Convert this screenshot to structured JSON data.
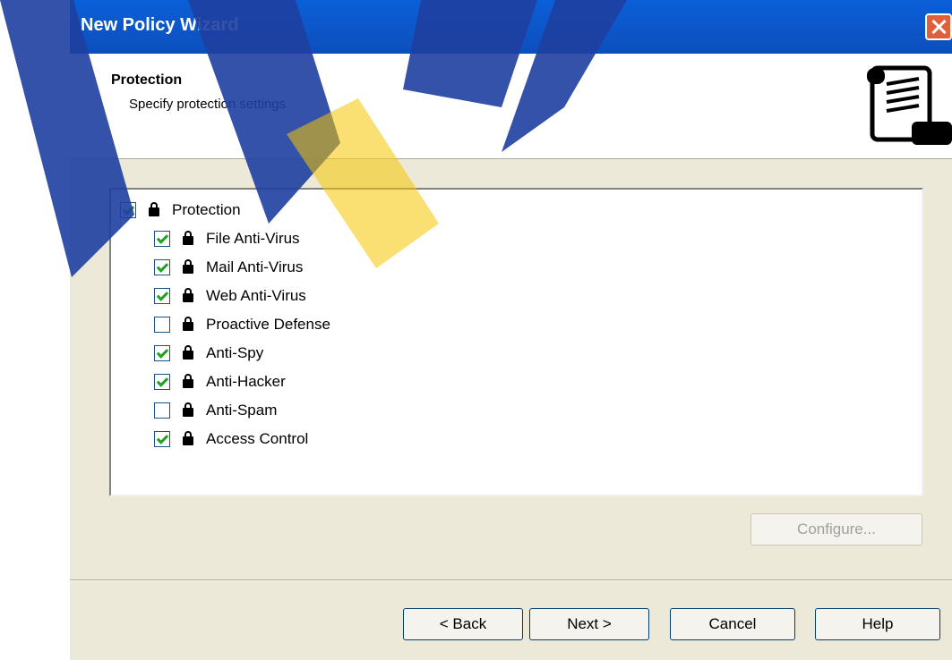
{
  "window": {
    "title": "New Policy Wizard"
  },
  "header": {
    "title": "Protection",
    "subtitle": "Specify protection settings"
  },
  "tree": {
    "root": {
      "label": "Protection",
      "checked": true
    },
    "items": [
      {
        "label": "File Anti-Virus",
        "checked": true
      },
      {
        "label": "Mail Anti-Virus",
        "checked": true
      },
      {
        "label": "Web Anti-Virus",
        "checked": true
      },
      {
        "label": "Proactive Defense",
        "checked": false
      },
      {
        "label": "Anti-Spy",
        "checked": true
      },
      {
        "label": "Anti-Hacker",
        "checked": true
      },
      {
        "label": "Anti-Spam",
        "checked": false
      },
      {
        "label": "Access Control",
        "checked": true
      }
    ]
  },
  "buttons": {
    "configure": "Configure...",
    "back": "< Back",
    "next": "Next >",
    "cancel": "Cancel",
    "help": "Help"
  },
  "icons": {
    "header_icon": "scroll-document-icon",
    "item_icon": "lock-icon",
    "close": "close-icon"
  },
  "colors": {
    "titlebar": "#0b55c8",
    "dialog_bg": "#ece9d8",
    "checkmark": "#21a121"
  }
}
